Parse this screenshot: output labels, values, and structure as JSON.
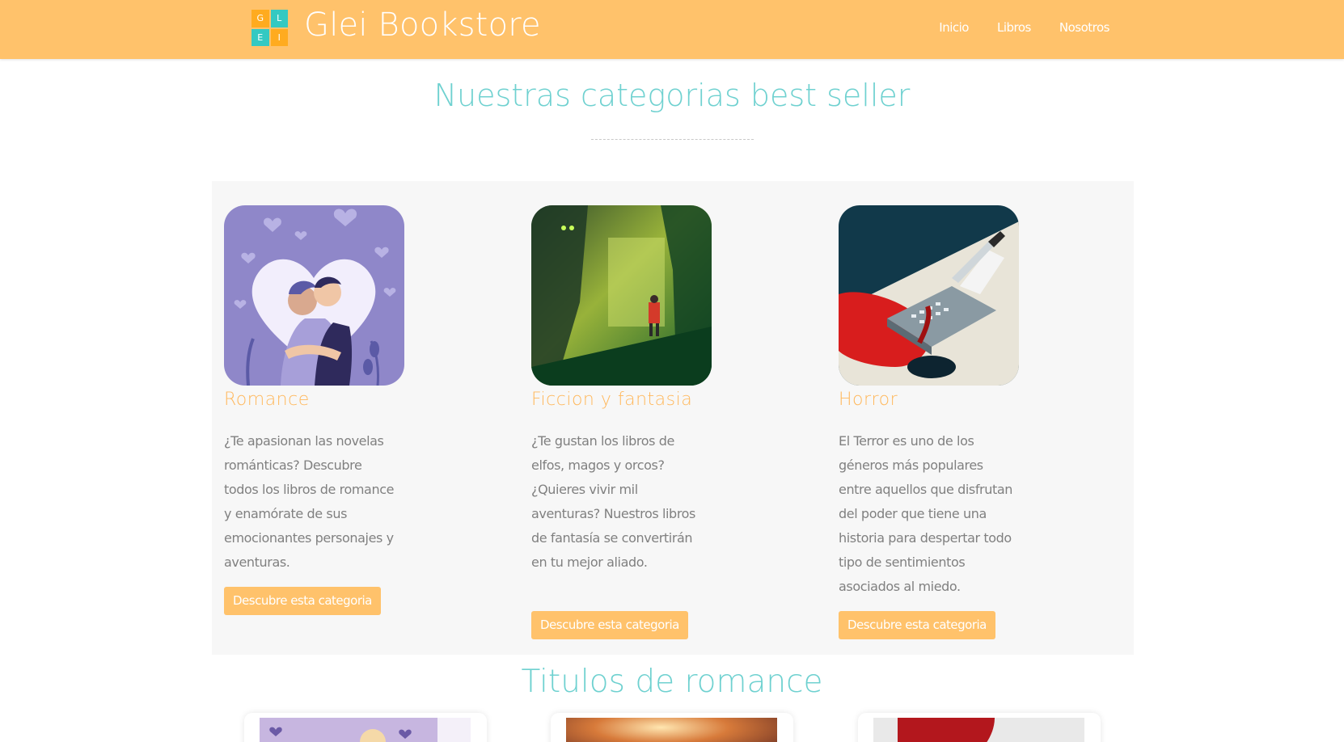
{
  "header": {
    "logo_letters": [
      "G",
      "L",
      "E",
      "I"
    ],
    "brand": "Glei Bookstore",
    "nav": [
      "Inicio",
      "Libros",
      "Nosotros"
    ],
    "colors": {
      "bar": "#ffc26b",
      "logo_orange": "#ffab1f",
      "logo_teal": "#34c9c2"
    }
  },
  "categories_section": {
    "title": "Nuestras categorias best seller",
    "cards": [
      {
        "image_icon": "romance-couple-illustration",
        "title": "Romance",
        "text": "¿Te apasionan las novelas románticas? Descubre todos los libros de romance y enamórate de sus emocionantes personajes y aventuras.",
        "button": "Descubre esta categoria"
      },
      {
        "image_icon": "fantasy-forest-illustration",
        "title": "Ficcion y fantasia",
        "text": "¿Te gustan los libros de elfos, magos y orcos? ¿Quieres vivir mil aventuras? Nuestros libros de fantasía se convertirán en tu mejor aliado.",
        "button": "Descubre esta categoria"
      },
      {
        "image_icon": "horror-typewriter-illustration",
        "title": "Horror",
        "text": "El Terror es uno de los géneros más populares entre aquellos que disfrutan del poder que tiene una historia para despertar todo tipo de sentimientos asociados al miedo.",
        "button": "Descubre esta categoria"
      }
    ]
  },
  "romance_section": {
    "title": "Titulos de romance"
  },
  "theme": {
    "accent": "#ffc26b",
    "heading_teal": "#6fd1d0",
    "card_title": "#ffb85c",
    "body_text": "#808080",
    "panel_bg": "#f7f7f7"
  }
}
